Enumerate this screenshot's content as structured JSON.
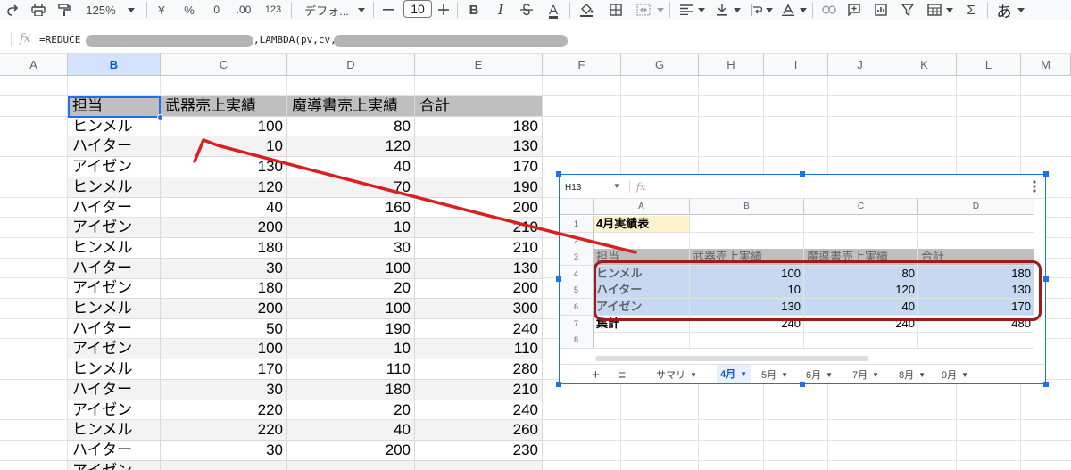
{
  "toolbar": {
    "zoom": "125%",
    "currency": "¥",
    "percent": "%",
    "dec_decrease": ".0",
    "dec_increase": ".00",
    "format_more": "123",
    "font": "デフォ...",
    "font_size": "10",
    "bold": "B",
    "italic": "I",
    "text_color": "A",
    "input_method": "あ"
  },
  "formula_bar": {
    "fx": "fx",
    "part1": "=REDUCE",
    "part2": ",LAMBDA(pv,cv,"
  },
  "grid": {
    "columns": [
      "A",
      "B",
      "C",
      "D",
      "E",
      "F",
      "G",
      "H",
      "I",
      "J",
      "K",
      "L",
      "M"
    ],
    "selected_column": "B",
    "header": [
      "担当",
      "武器売上実績",
      "魔導書売上実績",
      "合計"
    ],
    "rows": [
      [
        "ヒンメル",
        "100",
        "80",
        "180"
      ],
      [
        "ハイター",
        "10",
        "120",
        "130"
      ],
      [
        "アイゼン",
        "130",
        "40",
        "170"
      ],
      [
        "ヒンメル",
        "120",
        "70",
        "190"
      ],
      [
        "ハイター",
        "40",
        "160",
        "200"
      ],
      [
        "アイゼン",
        "200",
        "10",
        "210"
      ],
      [
        "ヒンメル",
        "180",
        "30",
        "210"
      ],
      [
        "ハイター",
        "30",
        "100",
        "130"
      ],
      [
        "アイゼン",
        "180",
        "20",
        "200"
      ],
      [
        "ヒンメル",
        "200",
        "100",
        "300"
      ],
      [
        "ハイター",
        "50",
        "190",
        "240"
      ],
      [
        "アイゼン",
        "100",
        "10",
        "110"
      ],
      [
        "ヒンメル",
        "170",
        "110",
        "280"
      ],
      [
        "ハイター",
        "30",
        "180",
        "210"
      ],
      [
        "アイゼン",
        "220",
        "20",
        "240"
      ],
      [
        "ヒンメル",
        "220",
        "40",
        "260"
      ],
      [
        "ハイター",
        "30",
        "200",
        "230"
      ],
      [
        "アイゼン",
        "",
        "",
        ""
      ]
    ]
  },
  "embedded": {
    "name_box": "H13",
    "fx": "fx",
    "columns": [
      "A",
      "B",
      "C",
      "D"
    ],
    "row_numbers": [
      "1",
      "2",
      "3",
      "4",
      "5",
      "6",
      "7",
      "8"
    ],
    "title": "4月実績表",
    "header": [
      "担当",
      "武器売上実績",
      "魔導書売上実績",
      "合計"
    ],
    "rows": [
      [
        "ヒンメル",
        "100",
        "80",
        "180"
      ],
      [
        "ハイター",
        "10",
        "120",
        "130"
      ],
      [
        "アイゼン",
        "130",
        "40",
        "170"
      ]
    ],
    "total": [
      "集計",
      "240",
      "240",
      "480"
    ],
    "tabs": [
      "サマリ",
      "4月",
      "5月",
      "6月",
      "7月",
      "8月",
      "9月"
    ],
    "active_tab": "4月",
    "add_sheet": "+",
    "all_sheets": "≡"
  },
  "colors": {
    "selection": "#1a73e8",
    "annotation_red": "#d92020",
    "highlight_box": "#9b1c1c",
    "embedded_highlight": "#c6d9f0"
  }
}
